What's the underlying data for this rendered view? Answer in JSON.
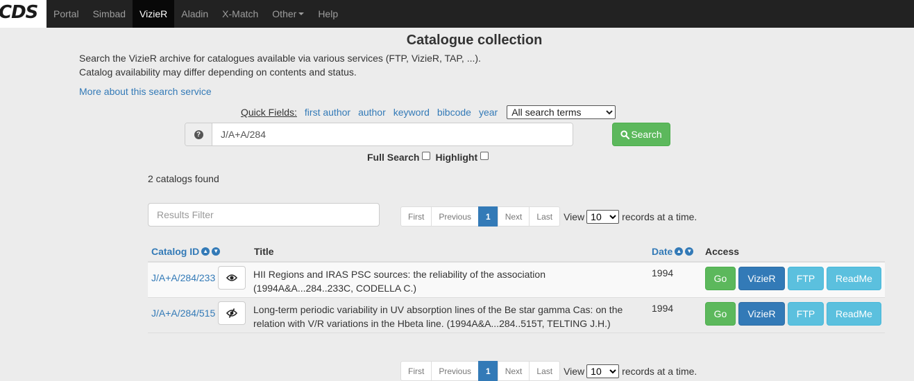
{
  "nav": {
    "logo": "CDS",
    "items": [
      {
        "label": "Portal"
      },
      {
        "label": "Simbad"
      },
      {
        "label": "VizieR"
      },
      {
        "label": "Aladin"
      },
      {
        "label": "X-Match"
      },
      {
        "label": "Other"
      },
      {
        "label": "Help"
      }
    ],
    "active": "VizieR"
  },
  "page": {
    "title": "Catalogue collection",
    "intro_line1": "Search the VizieR archive for catalogues available via various services (FTP, VizieR, TAP, ...).",
    "intro_line2": "Catalog availability may differ depending on contents and status.",
    "more_link": "More about this search service"
  },
  "quick_fields": {
    "label": "Quick Fields:",
    "links": [
      "first author",
      "author",
      "keyword",
      "bibcode",
      "year"
    ],
    "select_value": "All search terms"
  },
  "search": {
    "value": "J/A+A/284",
    "button_label": "Search",
    "full_search_label": "Full Search",
    "full_search_checked": false,
    "highlight_label": "Highlight",
    "highlight_checked": false
  },
  "results": {
    "count_text": "2 catalogs found",
    "filter_placeholder": "Results Filter"
  },
  "pagination": {
    "first": "First",
    "previous": "Previous",
    "current": "1",
    "next": "Next",
    "last": "Last",
    "view_label": "View",
    "per_page": "10",
    "records_label": "records at a time."
  },
  "table": {
    "headers": {
      "catalog_id": "Catalog ID",
      "title": "Title",
      "date": "Date",
      "access": "Access"
    },
    "rows": [
      {
        "catalog_id": "J/A+A/284/233",
        "title_line1": "HII Regions and IRAS PSC sources: the reliability of the association",
        "title_line2": "(1994A&A...284..233C, CODELLA C.)",
        "date": "1994",
        "eye_icon": "eye-icon"
      },
      {
        "catalog_id": "J/A+A/284/515",
        "title_line1": "Long-term periodic variability in UV absorption lines of the Be star gamma Cas: on the",
        "title_line2": "relation with V/R variations in the Hbeta line. (1994A&A...284..515T, TELTING J.H.)",
        "date": "1994",
        "eye_icon": "eye-slash-icon"
      }
    ],
    "access_buttons": {
      "go": "Go",
      "vizier": "VizieR",
      "ftp": "FTP",
      "readme": "ReadMe"
    }
  }
}
